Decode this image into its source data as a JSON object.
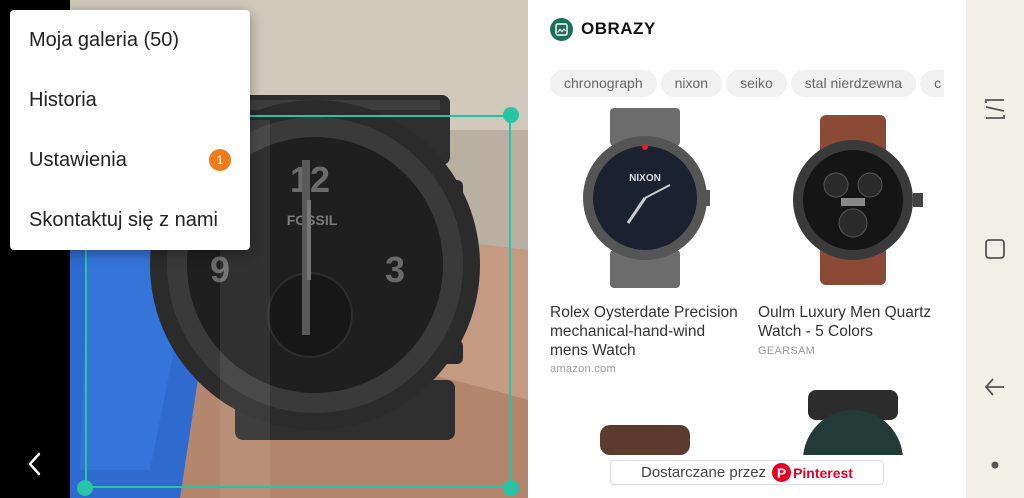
{
  "menu": {
    "items": [
      {
        "label": "Moja galeria (50)"
      },
      {
        "label": "Historia"
      },
      {
        "label": "Ustawienia",
        "badge": "1"
      },
      {
        "label": "Skontaktuj się z nami"
      }
    ]
  },
  "results": {
    "section_title": "OBRAZY",
    "chips": [
      "chronograph",
      "nixon",
      "seiko",
      "stal nierdzewna",
      "c"
    ],
    "cards": [
      {
        "title": "Rolex Oysterdate Precision mechanical-hand-wind mens Watch",
        "source": "amazon.com"
      },
      {
        "title": "Oulm Luxury Men Quartz Watch - 5 Colors",
        "source": "GEARSAM"
      }
    ],
    "provider_label": "Dostarczane przez",
    "provider_logo_letter": "P",
    "provider_name": "Pinterest"
  },
  "colors": {
    "accent": "#27c4a8",
    "badge": "#f07b1b",
    "pinterest": "#e60023",
    "section_icon": "#1d6f5b"
  },
  "icons": {
    "back": "chevron-left-icon",
    "section": "image-icon",
    "nav_recents": "recents-icon",
    "nav_home": "home-icon",
    "nav_back": "back-arrow-icon",
    "nav_dot": "dot-icon"
  }
}
